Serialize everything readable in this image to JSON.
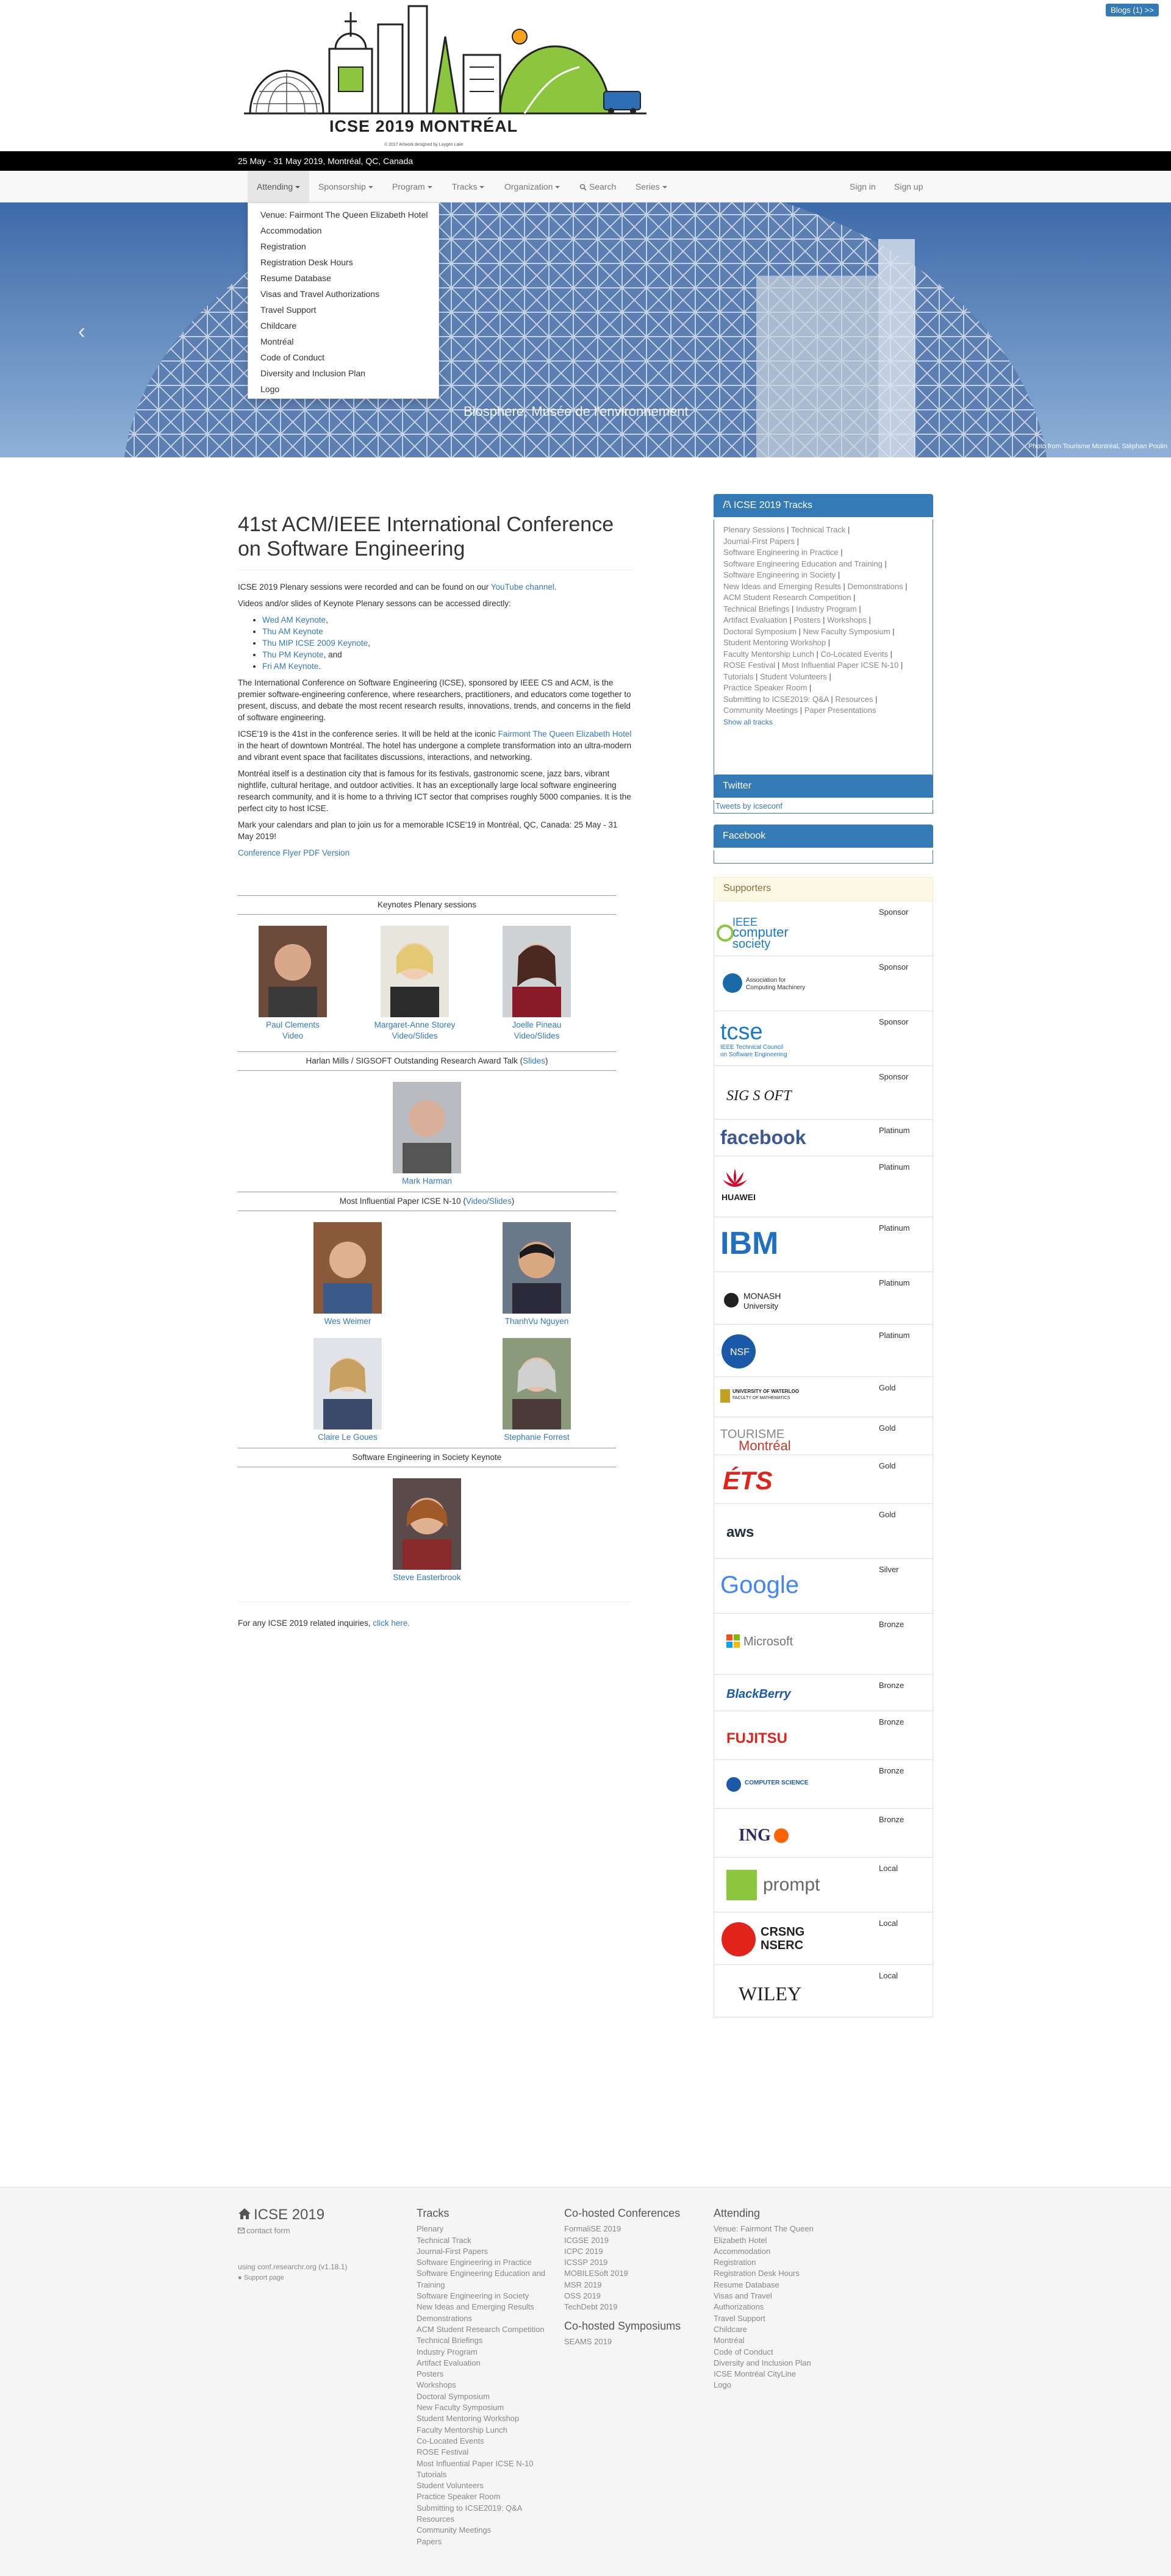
{
  "topbar": {
    "blogs_label": "Blogs (1) >>"
  },
  "logo": {
    "title": "ICSE 2019 MONTRÉAL",
    "credit": "© 2017 Artwork designed by Luygen Lake"
  },
  "datebar": {
    "text": "25 May - 31 May 2019, Montréal, QC, Canada"
  },
  "nav": {
    "items": [
      "Attending",
      "Sponsorship",
      "Program",
      "Tracks",
      "Organization",
      "Search",
      "Series"
    ],
    "sign_in": "Sign in",
    "sign_up": "Sign up"
  },
  "dropdown": {
    "items": [
      "Venue: Fairmont The Queen Elizabeth Hotel",
      "Accommodation",
      "Registration",
      "Registration Desk Hours",
      "Resume Database",
      "Visas and Travel Authorizations",
      "Travel Support",
      "Childcare",
      "Montréal",
      "Code of Conduct",
      "Diversity and Inclusion Plan",
      "Logo"
    ]
  },
  "hero": {
    "caption": "Biosphere, Musée de l'environnement",
    "credit": "Photo from Tourisme Montréal, Stéphan Poulin"
  },
  "main": {
    "title": "41st ACM/IEEE International Conference on Software Engineering",
    "p1_prefix": "ICSE 2019 Plenary sessions were recorded and can be found on our",
    "p1_link": "YouTube channel",
    "p1_suffix": ".",
    "p2": "Videos and/or slides of Keynote Plenary sessons can be accessed directly:",
    "keynote_links": [
      "Wed AM Keynote",
      "Thu AM Keynote",
      "Thu MIP ICSE 2009 Keynote",
      "Thu PM Keynote",
      "Fri AM Keynote"
    ],
    "keynote_suffixes": [
      ",",
      "",
      ",",
      ", and",
      "."
    ],
    "p3": "The International Conference on Software Engineering (ICSE), sponsored by IEEE CS and ACM, is the premier software-engineering conference, where researchers, practitioners, and educators come together to present, discuss, and debate the most recent research results, innovations, trends, and concerns in the field of software engineering.",
    "p4_prefix": "ICSE'19 is the 41st in the conference series. It will be held at the iconic",
    "p4_link": "Fairmont The Queen Elizabeth Hotel",
    "p4_suffix": "in the heart of downtown Montréal. The hotel has undergone a complete transformation into an ultra-modern and vibrant event space that facilitates discussions, interactions, and networking.",
    "p5": "Montréal itself is a destination city that is famous for its festivals, gastronomic scene, jazz bars, vibrant nightlife, cultural heritage, and outdoor activities. It has an exceptionally large local software engineering research community, and it is home to a thriving ICT sector that comprises roughly 5000 companies. It is the perfect city to host ICSE.",
    "p6": "Mark your calendars and plan to join us for a memorable ICSE'19 in Montréal, QC, Canada: 25 May - 31 May 2019!",
    "flyer_link": "Conference Flyer PDF Version",
    "sections": {
      "keynotes": "Keynotes Plenary sessions",
      "harlan_prefix": "Harlan Mills / SIGSOFT Outstanding Research Award Talk (",
      "harlan_link": "Slides",
      "harlan_suffix": ")",
      "mip_prefix": "Most Influential Paper ICSE N-10 (",
      "mip_link": "Video/Slides",
      "mip_suffix": ")",
      "society": "Software Engineering in Society Keynote"
    },
    "people": {
      "clements": {
        "name": "Paul Clements",
        "link": "Video"
      },
      "storey": {
        "name": "Margaret-Anne Storey",
        "link": "Video/Slides"
      },
      "pineau": {
        "name": "Joelle Pineau",
        "link": "Video/Slides"
      },
      "harman": {
        "name": "Mark Harman"
      },
      "weimer": {
        "name": "Wes Weimer"
      },
      "nguyen": {
        "name": "ThanhVu Nguyen"
      },
      "legoues": {
        "name": "Claire Le Goues"
      },
      "forrest": {
        "name": "Stephanie Forrest"
      },
      "easterbrook": {
        "name": "Steve Easterbrook"
      }
    },
    "inquiries_prefix": "For any ICSE 2019 related inquiries,",
    "inquiries_link": "click here."
  },
  "sidebar": {
    "tracks_title": "ICSE 2019 Tracks",
    "tracks": [
      "Plenary Sessions",
      "Technical Track",
      "Journal-First Papers",
      "Software Engineering in Practice",
      "Software Engineering Education and Training",
      "Software Engineering in Society",
      "New Ideas and Emerging Results",
      "Demonstrations",
      "ACM Student Research Competition",
      "Technical Briefings",
      "Industry Program",
      "Artifact Evaluation",
      "Posters",
      "Workshops",
      "Doctoral Symposium",
      "New Faculty Symposium",
      "Student Mentoring Workshop",
      "Faculty Mentorship Lunch",
      "Co-Located Events",
      "ROSE Festival",
      "Most Influential Paper ICSE N-10",
      "Tutorials",
      "Student Volunteers",
      "Practice Speaker Room",
      "Submitting to ICSE2019: Q&A",
      "Resources",
      "Community Meetings",
      "Paper Presentations"
    ],
    "show_all": "Show all tracks",
    "twitter_title": "Twitter",
    "twitter_link": "Tweets by icseconf",
    "facebook_title": "Facebook",
    "supporters_title": "Supporters",
    "supporters": [
      {
        "name": "IEEE computer society",
        "level": "Sponsor"
      },
      {
        "name": "ACM Association for Computing Machinery",
        "level": "Sponsor"
      },
      {
        "name": "tcse IEEE Technical Council on Software Engineering",
        "level": "Sponsor"
      },
      {
        "name": "SIGSOFT",
        "level": "Sponsor"
      },
      {
        "name": "facebook",
        "level": "Platinum"
      },
      {
        "name": "HUAWEI",
        "level": "Platinum"
      },
      {
        "name": "IBM",
        "level": "Platinum"
      },
      {
        "name": "MONASH University",
        "level": "Platinum"
      },
      {
        "name": "NSF",
        "level": "Platinum"
      },
      {
        "name": "UNIVERSITY OF WATERLOO",
        "level": "Gold"
      },
      {
        "name": "TOURISME Montréal",
        "level": "Gold"
      },
      {
        "name": "ÉTS",
        "level": "Gold"
      },
      {
        "name": "aws",
        "level": "Gold"
      },
      {
        "name": "Google",
        "level": "Silver"
      },
      {
        "name": "Microsoft",
        "level": "Bronze"
      },
      {
        "name": "BlackBerry",
        "level": "Bronze"
      },
      {
        "name": "FUJITSU",
        "level": "Bronze"
      },
      {
        "name": "COMPUTER SCIENCE",
        "level": "Bronze"
      },
      {
        "name": "ING",
        "level": "Bronze"
      },
      {
        "name": "prompt",
        "level": "Local"
      },
      {
        "name": "CRSNG NSERC",
        "level": "Local"
      },
      {
        "name": "WILEY",
        "level": "Local"
      }
    ]
  },
  "footer": {
    "brand": "ICSE 2019",
    "contact": "contact form",
    "using": "using conf.researchr.org (v1.18.1)",
    "support": "Support page",
    "tracks_title": "Tracks",
    "tracks": [
      "Plenary",
      "Technical Track",
      "Journal-First Papers",
      "Software Engineering in Practice",
      "Software Engineering Education and",
      "Training",
      "Software Engineering in Society",
      "New Ideas and Emerging Results",
      "Demonstrations",
      "ACM Student Research Competition",
      "Technical Briefings",
      "Industry Program",
      "Artifact Evaluation",
      "Posters",
      "Workshops",
      "Doctoral Symposium",
      "New Faculty Symposium",
      "Student Mentoring Workshop",
      "Faculty Mentorship Lunch",
      "Co-Located Events",
      "ROSE Festival",
      "Most Influential Paper ICSE N-10",
      "Tutorials",
      "Student Volunteers",
      "Practice Speaker Room",
      "Submitting to ICSE2019: Q&A",
      "Resources",
      "Community Meetings",
      "Papers"
    ],
    "cohosted_title": "Co-hosted Conferences",
    "cohosted": [
      "FormaliSE 2019",
      "ICGSE 2019",
      "ICPC 2019",
      "ICSSP 2019",
      "MOBILESoft 2019",
      "MSR 2019",
      "OSS 2019",
      "TechDebt 2019"
    ],
    "symposiums_title": "Co-hosted Symposiums",
    "symposiums": [
      "SEAMS 2019"
    ],
    "attending_title": "Attending",
    "attending": [
      "Venue: Fairmont The Queen",
      "Elizabeth Hotel",
      "Accommodation",
      "Registration",
      "Registration Desk Hours",
      "Resume Database",
      "Visas and Travel",
      "Authorizations",
      "Travel Support",
      "Childcare",
      "Montréal",
      "Code of Conduct",
      "Diversity and Inclusion Plan",
      "ICSE Montréal CityLine",
      "Logo"
    ]
  }
}
